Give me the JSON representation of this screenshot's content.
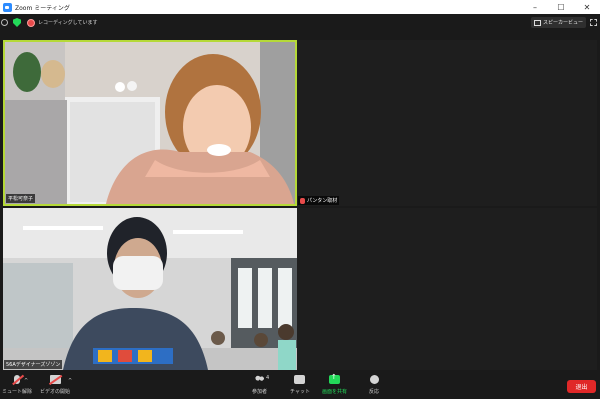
{
  "window": {
    "title": "Zoom ミーティング",
    "controls": [
      "–",
      "☐",
      "✕"
    ]
  },
  "status": {
    "recording_text": "レコーディングしています",
    "speaker_view": "スピーカービュー"
  },
  "participants": [
    {
      "name": "平松可奈子",
      "muted": false,
      "active_speaker": true
    },
    {
      "name": "パンタン取材",
      "muted": true,
      "active_speaker": false
    },
    {
      "name": "56Aデザイナーズゾゾン",
      "muted": false,
      "active_speaker": false
    },
    {
      "name": "",
      "muted": false,
      "active_speaker": false
    }
  ],
  "toolbar": {
    "mute_label": "ミュート解除",
    "video_label": "ビデオの開始",
    "participants_label": "参加者",
    "participants_count": "4",
    "chat_label": "チャット",
    "share_label": "画面を共有",
    "reactions_label": "反応",
    "leave_label": "退出"
  },
  "colors": {
    "active_border": "#b5d938",
    "leave": "#e02828",
    "share": "#23d959",
    "record": "#e84b4b"
  }
}
